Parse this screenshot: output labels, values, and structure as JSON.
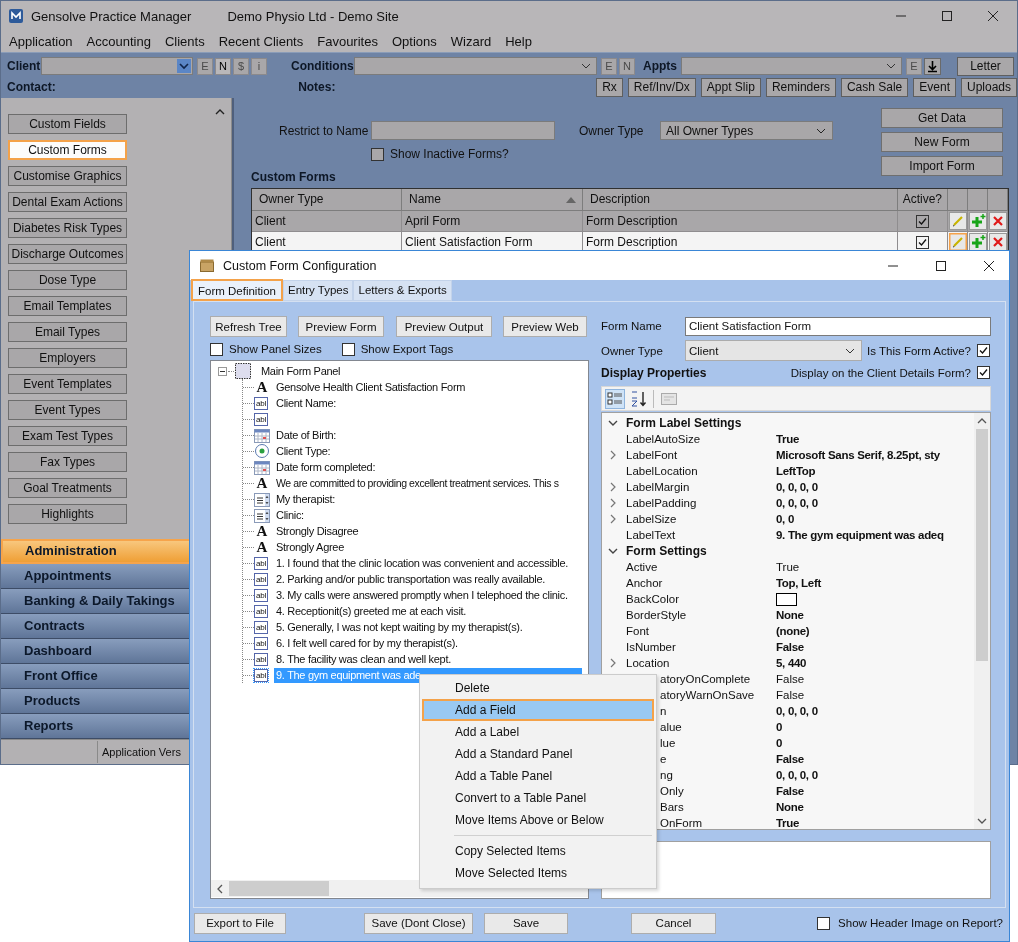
{
  "window": {
    "title": "Gensolve Practice Manager",
    "subtitle": "Demo Physio Ltd - Demo Site"
  },
  "menu": [
    "Application",
    "Accounting",
    "Clients",
    "Recent Clients",
    "Favourites",
    "Options",
    "Wizard",
    "Help"
  ],
  "toolbar": {
    "client_label": "Client",
    "client_buttons": [
      {
        "label": "E",
        "disabled": true
      },
      {
        "label": "N",
        "disabled": false
      },
      {
        "label": "$",
        "disabled": true
      },
      {
        "label": "i",
        "disabled": true
      }
    ],
    "conditions_label": "Conditions",
    "conditions_buttons": [
      {
        "label": "E",
        "disabled": true
      },
      {
        "label": "N",
        "disabled": true
      }
    ],
    "appts_label": "Appts",
    "appts_buttons": [
      {
        "label": "E",
        "disabled": true
      }
    ],
    "letter": "Letter",
    "contact_label": "Contact:",
    "notes_label": "Notes:",
    "actions": [
      "Rx",
      "Ref/Inv/Dx",
      "Appt Slip",
      "Reminders",
      "Cash Sale",
      "Event",
      "Uploads"
    ]
  },
  "sidebar": {
    "items": [
      {
        "label": "Custom Fields",
        "selected": false
      },
      {
        "label": "Custom Forms",
        "selected": true
      },
      {
        "label": "Customise Graphics",
        "selected": false
      },
      {
        "label": "Dental Exam Actions",
        "selected": false
      },
      {
        "label": "Diabetes Risk Types",
        "selected": false
      },
      {
        "label": "Discharge Outcomes",
        "selected": false
      },
      {
        "label": "Dose Type",
        "selected": false
      },
      {
        "label": "Email Templates",
        "selected": false
      },
      {
        "label": "Email Types",
        "selected": false
      },
      {
        "label": "Employers",
        "selected": false
      },
      {
        "label": "Event Templates",
        "selected": false
      },
      {
        "label": "Event Types",
        "selected": false
      },
      {
        "label": "Exam Test Types",
        "selected": false
      },
      {
        "label": "Fax Types",
        "selected": false
      },
      {
        "label": "Goal Treatments",
        "selected": false
      },
      {
        "label": "Highlights",
        "selected": false
      }
    ],
    "nav": [
      {
        "label": "Administration",
        "selected": true
      },
      {
        "label": "Appointments",
        "selected": false
      },
      {
        "label": "Banking & Daily Takings",
        "selected": false
      },
      {
        "label": "Contracts",
        "selected": false
      },
      {
        "label": "Dashboard",
        "selected": false
      },
      {
        "label": "Front Office",
        "selected": false
      },
      {
        "label": "Products",
        "selected": false
      },
      {
        "label": "Reports",
        "selected": false
      }
    ],
    "status": "Application Vers"
  },
  "filter": {
    "restrict_label": "Restrict to Name",
    "owner_label": "Owner Type",
    "owner_value": "All Owner Types",
    "show_inactive": {
      "label": "Show Inactive Forms?",
      "checked": false
    },
    "buttons": [
      "Get Data",
      "New Form",
      "Import Form"
    ]
  },
  "table": {
    "title": "Custom Forms",
    "columns": [
      "Owner Type",
      "Name",
      "Description",
      "Active?"
    ],
    "rows": [
      {
        "owner_type": "Client",
        "name": "April Form",
        "description": "Form Description",
        "active": true,
        "selected": false
      },
      {
        "owner_type": "Client",
        "name": "Client Satisfaction Form",
        "description": "Form Description",
        "active": true,
        "selected": true
      }
    ]
  },
  "dialog": {
    "title": "Custom Form Configuration",
    "tabs": [
      {
        "label": "Form Definition",
        "selected": true
      },
      {
        "label": "Entry Types",
        "selected": false
      },
      {
        "label": "Letters & Exports",
        "selected": false
      }
    ],
    "tree_buttons": [
      "Refresh Tree",
      "Preview Form",
      "Preview Output",
      "Preview Web"
    ],
    "tree_options": [
      {
        "label": "Show Panel Sizes",
        "checked": false
      },
      {
        "label": "Show Export Tags",
        "checked": false
      }
    ],
    "tree": {
      "label": "Main Form Panel",
      "expanded": true,
      "children": [
        {
          "kind": "label",
          "icon": "A",
          "text": "Gensolve Health Client Satisfaction Form",
          "selected": false
        },
        {
          "kind": "field",
          "icon": "abl",
          "text": "Client Name:",
          "selected": false
        },
        {
          "kind": "field",
          "icon": "abl",
          "selected": false
        },
        {
          "kind": "date",
          "text": "Date of Birth:",
          "selected": false
        },
        {
          "kind": "radio",
          "text": "Client Type:",
          "selected": false
        },
        {
          "kind": "date",
          "text": "Date form completed:",
          "selected": false
        },
        {
          "kind": "label",
          "icon": "A",
          "text": "We are committed to providing excellent treatment services. This s",
          "selected": false
        },
        {
          "kind": "combo",
          "text": "My therapist:",
          "selected": false
        },
        {
          "kind": "combo",
          "text": "Clinic:",
          "selected": false
        },
        {
          "kind": "label",
          "icon": "A",
          "text": "Strongly Disagree",
          "selected": false
        },
        {
          "kind": "label",
          "icon": "A",
          "text": "Strongly Agree",
          "selected": false
        },
        {
          "kind": "field",
          "icon": "abl",
          "text": "1. I found that the clinic location was convenient and accessible.",
          "selected": false
        },
        {
          "kind": "field",
          "icon": "abl",
          "text": "2. Parking and/or public transportation was really available.",
          "selected": false
        },
        {
          "kind": "field",
          "icon": "abl",
          "text": "3. My calls were answered promptly when I telephoed the clinic.",
          "selected": false
        },
        {
          "kind": "field",
          "icon": "abl",
          "text": "4. Receptionit(s) greeted me at each visit.",
          "selected": false
        },
        {
          "kind": "field",
          "icon": "abl",
          "text": "5. Generally, I was not kept waiting by my therapist(s).",
          "selected": false
        },
        {
          "kind": "field",
          "icon": "abl",
          "text": "6. I felt well cared for by my therapist(s).",
          "selected": false
        },
        {
          "kind": "field",
          "icon": "abl",
          "text": "8. The facility was clean and well kept.",
          "selected": false
        },
        {
          "kind": "field",
          "icon": "abl",
          "text": "9. The gym equipment was ade",
          "selected": true
        }
      ]
    },
    "form_name_label": "Form Name",
    "form_name": "Client Satisfaction Form",
    "owner_type_label": "Owner Type",
    "owner_type": "Client",
    "active": {
      "label": "Is This Form Active?",
      "checked": true
    },
    "display_properties": "Display Properties",
    "display_on_client": {
      "label": "Display on the Client Details Form?",
      "checked": true
    },
    "properties": [
      {
        "kind": "category",
        "name": "Form Label Settings",
        "expanded": true
      },
      {
        "kind": "property",
        "name": "LabelAutoSize",
        "value": "True",
        "bold": true,
        "expandable": false
      },
      {
        "kind": "property",
        "name": "LabelFont",
        "value": "Microsoft Sans Serif, 8.25pt, sty",
        "bold": true,
        "expandable": true
      },
      {
        "kind": "property",
        "name": "LabelLocation",
        "value": "LeftTop",
        "bold": true,
        "expandable": false
      },
      {
        "kind": "property",
        "name": "LabelMargin",
        "value": "0, 0, 0, 0",
        "bold": true,
        "expandable": true
      },
      {
        "kind": "property",
        "name": "LabelPadding",
        "value": "0, 0, 0, 0",
        "bold": true,
        "expandable": true
      },
      {
        "kind": "property",
        "name": "LabelSize",
        "value": "0, 0",
        "bold": true,
        "expandable": true
      },
      {
        "kind": "property",
        "name": "LabelText",
        "value": "9. The gym equipment was adeq",
        "bold": true,
        "expandable": false
      },
      {
        "kind": "category",
        "name": "Form Settings",
        "expanded": true
      },
      {
        "kind": "property",
        "name": "Active",
        "value": "True",
        "bold": false,
        "expandable": false
      },
      {
        "kind": "property",
        "name": "Anchor",
        "value": "Top, Left",
        "bold": true,
        "expandable": false
      },
      {
        "kind": "color",
        "name": "BackColor"
      },
      {
        "kind": "property",
        "name": "BorderStyle",
        "value": "None",
        "bold": true,
        "expandable": false
      },
      {
        "kind": "property",
        "name": "Font",
        "value": "(none)",
        "bold": true,
        "expandable": false
      },
      {
        "kind": "property",
        "name": "IsNumber",
        "value": "False",
        "bold": true,
        "expandable": false
      },
      {
        "kind": "property",
        "name": "Location",
        "value": "5, 440",
        "bold": true,
        "expandable": true
      },
      {
        "kind": "property",
        "name": "atoryOnComplete",
        "value": "False",
        "bold": false,
        "expandable": false,
        "covered": true
      },
      {
        "kind": "property",
        "name": "atoryWarnOnSave",
        "value": "False",
        "bold": false,
        "expandable": false,
        "covered": true
      },
      {
        "kind": "property",
        "name": "n",
        "value": "0, 0, 0, 0",
        "bold": true,
        "expandable": false,
        "covered": true
      },
      {
        "kind": "property",
        "name": "alue",
        "value": "0",
        "bold": true,
        "expandable": false,
        "covered": true
      },
      {
        "kind": "property",
        "name": "lue",
        "value": "0",
        "bold": true,
        "expandable": false,
        "covered": true
      },
      {
        "kind": "property",
        "name": "e",
        "value": "False",
        "bold": true,
        "expandable": false,
        "covered": true
      },
      {
        "kind": "property",
        "name": "ng",
        "value": "0, 0, 0, 0",
        "bold": true,
        "expandable": false,
        "covered": true
      },
      {
        "kind": "property",
        "name": "Only",
        "value": "False",
        "bold": true,
        "expandable": false,
        "covered": true
      },
      {
        "kind": "property",
        "name": "Bars",
        "value": "None",
        "bold": true,
        "expandable": false,
        "covered": true
      },
      {
        "kind": "property",
        "name": "OnForm",
        "value": "True",
        "bold": true,
        "expandable": false,
        "covered": true
      }
    ],
    "footer_buttons": [
      "Export to File",
      "Save (Dont Close)",
      "Save",
      "Cancel"
    ],
    "header_image": {
      "label": "Show Header Image on Report?",
      "checked": false
    }
  },
  "context_menu": {
    "groups": [
      [
        {
          "label": "Delete",
          "selected": false
        },
        {
          "label": "Add a Field",
          "selected": true
        },
        {
          "label": "Add a Label",
          "selected": false
        },
        {
          "label": "Add a Standard Panel",
          "selected": false
        },
        {
          "label": "Add a Table Panel",
          "selected": false
        },
        {
          "label": "Convert to a Table Panel",
          "selected": false
        },
        {
          "label": "Move Items Above or Below",
          "selected": false
        }
      ],
      [
        {
          "label": "Copy Selected Items",
          "selected": false
        },
        {
          "label": "Move Selected Items",
          "selected": false
        }
      ]
    ]
  }
}
